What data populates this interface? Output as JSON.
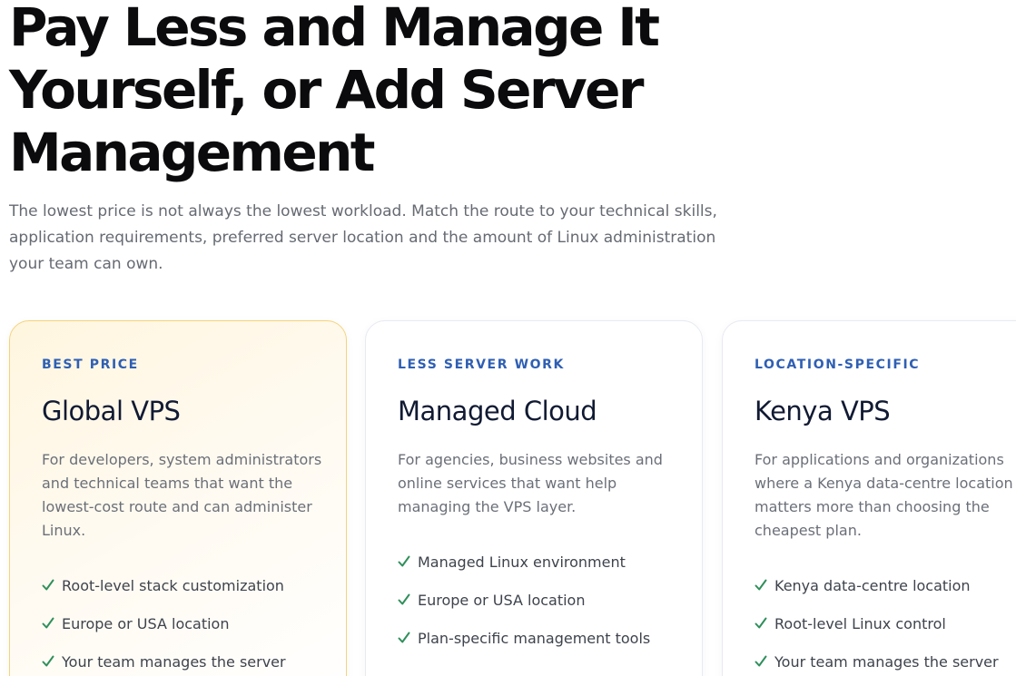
{
  "hero": {
    "title": "Pay Less and Manage It Yourself, or Add Server Management",
    "lead": "The lowest price is not always the lowest workload. Match the route to your technical skills, application requirements, preferred server location and the amount of Linux administration your team can own."
  },
  "colors": {
    "accent": "#2f5fb3",
    "check": "#2f8f5b",
    "featured_border": "#f4d37a",
    "heading": "#0b0b0d"
  },
  "cards": [
    {
      "eyebrow": "BEST PRICE",
      "title": "Global VPS",
      "description": "For developers, system administrators and technical teams that want the lowest-cost route and can administer Linux.",
      "features": [
        "Root-level stack customization",
        "Europe or USA location",
        "Your team manages the server"
      ]
    },
    {
      "eyebrow": "LESS SERVER WORK",
      "title": "Managed Cloud",
      "description": "For agencies, business websites and online services that want help managing the VPS layer.",
      "features": [
        "Managed Linux environment",
        "Europe or USA location",
        "Plan-specific management tools"
      ]
    },
    {
      "eyebrow": "LOCATION-SPECIFIC",
      "title": "Kenya VPS",
      "description": "For applications and organizations where a Kenya data-centre location matters more than choosing the cheapest plan.",
      "features": [
        "Kenya data-centre location",
        "Root-level Linux control",
        "Your team manages the server"
      ]
    }
  ]
}
